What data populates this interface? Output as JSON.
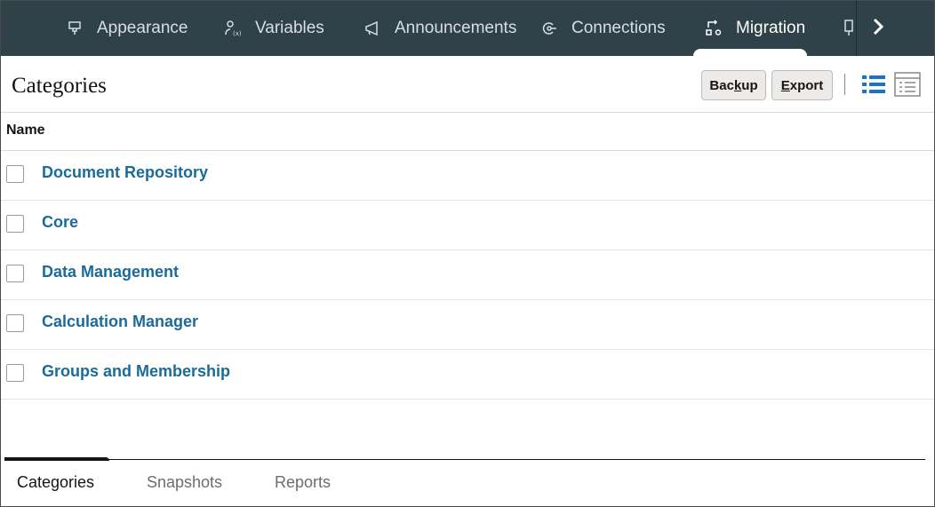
{
  "nav": {
    "tabs": [
      {
        "label": "Appearance",
        "icon": "appearance-icon"
      },
      {
        "label": "Variables",
        "icon": "variables-icon"
      },
      {
        "label": "Announcements",
        "icon": "megaphone-icon"
      },
      {
        "label": "Connections",
        "icon": "connections-icon"
      },
      {
        "label": "Migration",
        "icon": "migration-icon",
        "active": true
      }
    ],
    "next_icon": "chevron-right-icon"
  },
  "header": {
    "title": "Categories",
    "backup_label_pre": "Bac",
    "backup_label_key": "k",
    "backup_label_post": "up",
    "export_label_key": "E",
    "export_label_post": "xport",
    "list_view_icon": "list-view-icon",
    "detail_view_icon": "detail-view-icon"
  },
  "table": {
    "column_name": "Name",
    "rows": [
      {
        "name": "Document Repository"
      },
      {
        "name": "Core"
      },
      {
        "name": "Data Management"
      },
      {
        "name": "Calculation Manager"
      },
      {
        "name": "Groups and Membership"
      }
    ]
  },
  "bottom_tabs": [
    {
      "label": "Categories",
      "active": true
    },
    {
      "label": "Snapshots"
    },
    {
      "label": "Reports"
    }
  ],
  "colors": {
    "nav_bg": "#2f4249",
    "link": "#1a6b9a",
    "icon_blue": "#1a73c8"
  }
}
